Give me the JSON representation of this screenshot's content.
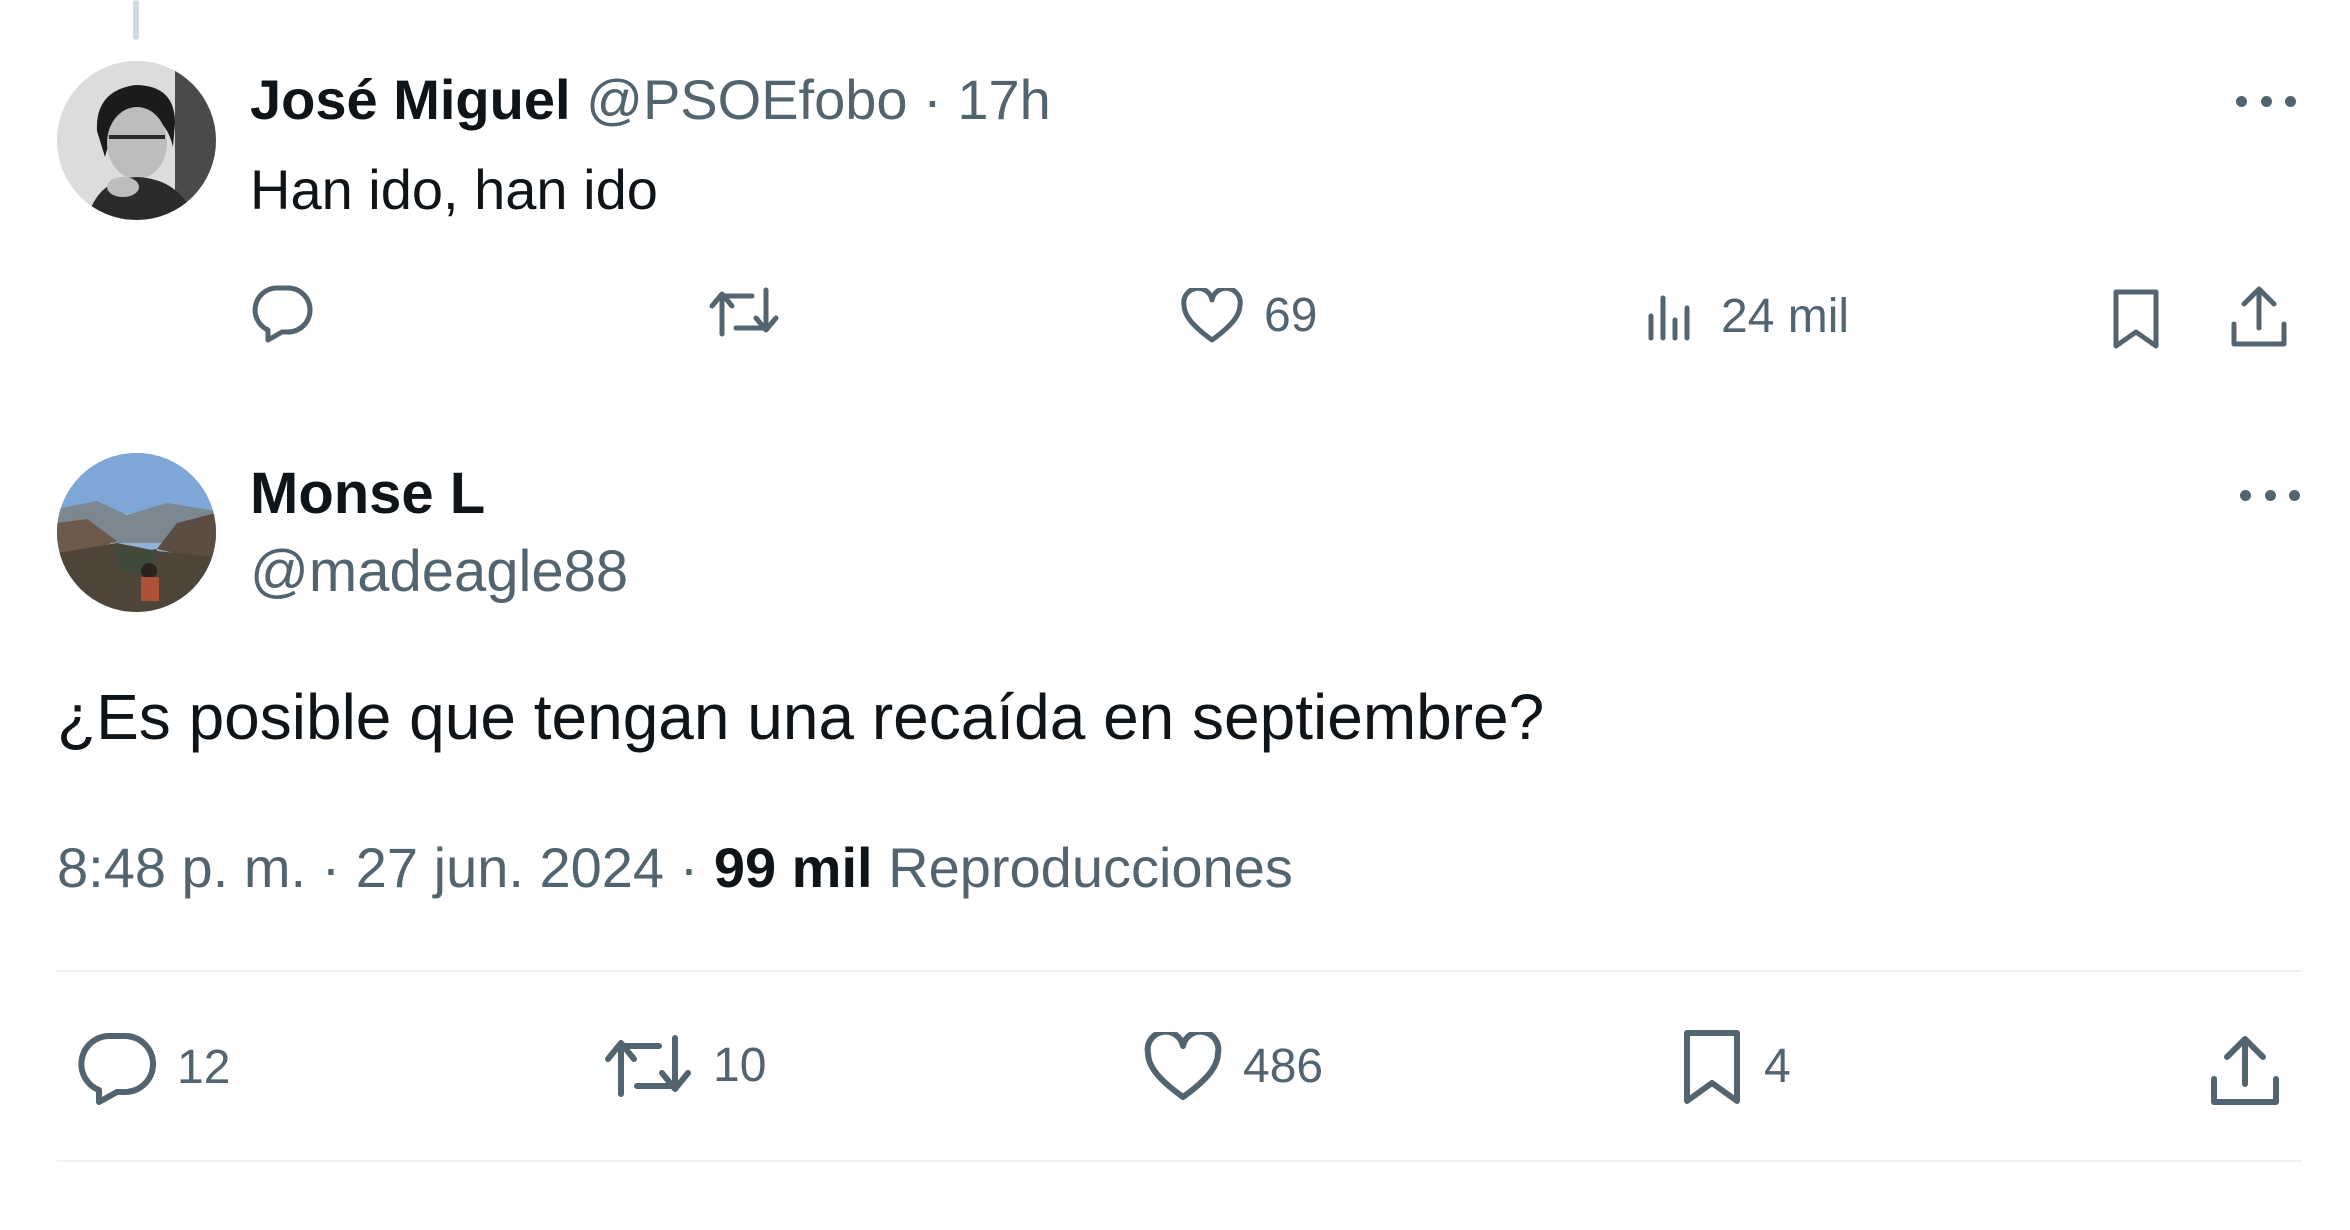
{
  "reply1": {
    "name": "José Miguel",
    "handle": "@PSOEfobo",
    "separator": "·",
    "time": "17h",
    "text": "Han ido, han ido",
    "likes": "69",
    "views": "24 mil"
  },
  "tweet2": {
    "name": "Monse L",
    "handle": "@madeagle88",
    "text": "¿Es posible que tengan una recaída en septiembre?",
    "timestamp": "8:48 p. m. · 27 jun. 2024 · ",
    "views_count": "99 mil",
    "views_label": "Reproducciones",
    "replies": "12",
    "retweets": "10",
    "likes": "486",
    "bookmarks": "4"
  },
  "colors": {
    "text_primary": "#0f1419",
    "text_secondary": "#536471",
    "divider": "#eff3f4"
  },
  "icons": [
    "reply-icon",
    "retweet-icon",
    "like-icon",
    "views-icon",
    "bookmark-icon",
    "share-icon",
    "more-icon"
  ]
}
